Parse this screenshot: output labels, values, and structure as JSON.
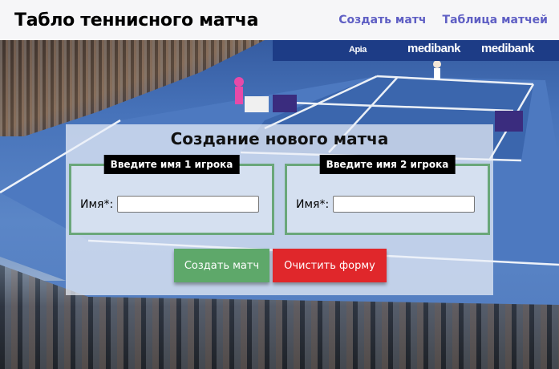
{
  "header": {
    "title": "Табло теннисного матча",
    "nav": [
      {
        "label": "Создать матч"
      },
      {
        "label": "Таблица матчей"
      }
    ]
  },
  "form": {
    "title": "Создание нового матча",
    "player1": {
      "legend": "Введите имя 1 игрока",
      "name_label": "Имя*:",
      "value": "",
      "placeholder": ""
    },
    "player2": {
      "legend": "Введите имя 2 игрока",
      "name_label": "Имя*:",
      "value": "",
      "placeholder": ""
    },
    "create_button": "Создать матч",
    "clear_button": "Очистить форму"
  },
  "background": {
    "banner_texts": [
      "Apia",
      "medibank",
      "medibank"
    ]
  },
  "colors": {
    "header_bg": "#f6f6f8",
    "nav_link": "#5f5fc4",
    "fieldset_border": "#6aa77a",
    "create_button": "#5ea86a",
    "clear_button": "#e0272b",
    "legend_bg": "#000000"
  }
}
